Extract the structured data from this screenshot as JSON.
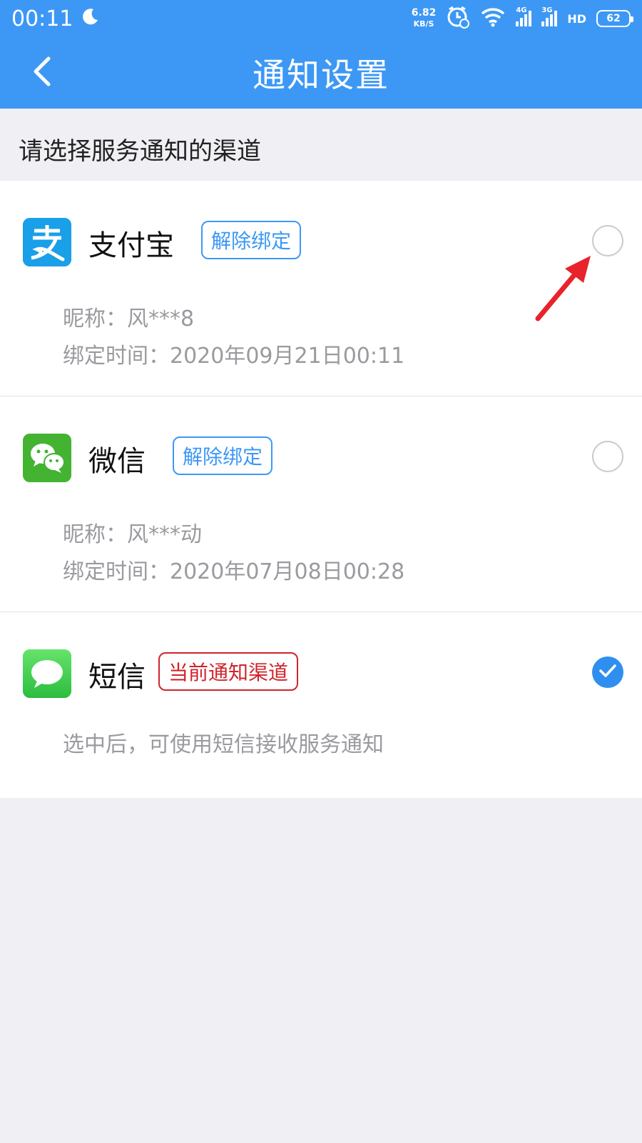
{
  "status_bar": {
    "time": "00:11",
    "net_speed_value": "6.82",
    "net_speed_unit": "KB/S",
    "signal_1_label": "4G",
    "signal_2_label": "3G",
    "hd_label": "HD",
    "battery_level": "62",
    "icons": [
      "moon-icon",
      "alarm-icon",
      "wifi-icon",
      "signal-icon",
      "battery-icon"
    ]
  },
  "nav": {
    "title": "通知设置",
    "back_icon": "back-arrow-icon"
  },
  "section_title": "请选择服务通知的渠道",
  "channels": [
    {
      "name": "支付宝",
      "icon": "alipay-icon",
      "action_label": "解除绑定",
      "nickname": "昵称：风***8",
      "bind_time": "绑定时间：2020年09月21日00:11",
      "selected": false
    },
    {
      "name": "微信",
      "icon": "wechat-icon",
      "action_label": "解除绑定",
      "nickname": "昵称：风***动",
      "bind_time": "绑定时间：2020年07月08日00:28",
      "selected": false
    },
    {
      "name": "短信",
      "icon": "sms-icon",
      "status_label": "当前通知渠道",
      "description": "选中后，可使用短信接收服务通知",
      "selected": true
    }
  ],
  "colors": {
    "header_blue": "#3d98f5",
    "check_blue": "#2f8ff0",
    "current_red": "#d0242a",
    "arrow_red": "#e8232b"
  }
}
